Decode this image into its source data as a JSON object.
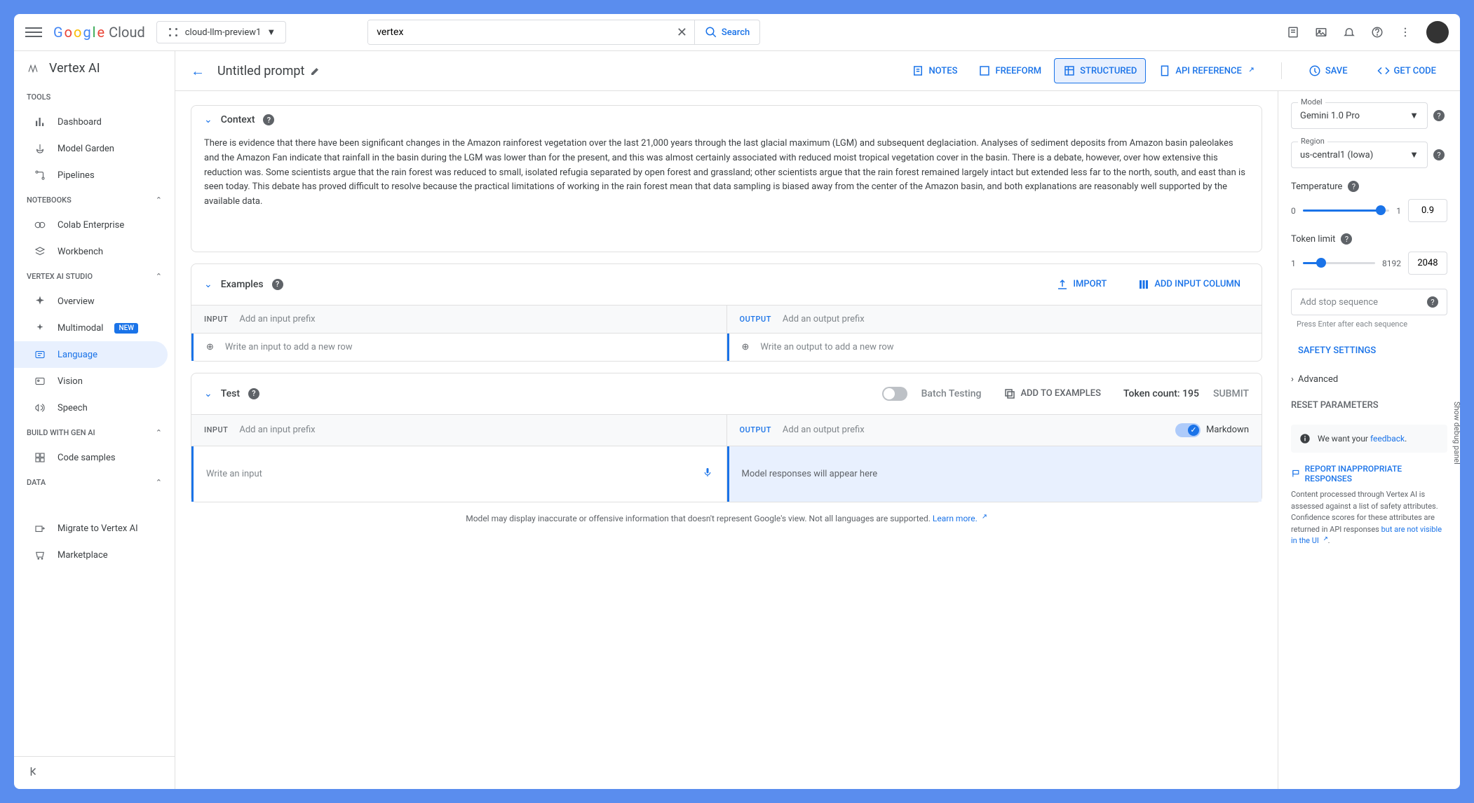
{
  "header": {
    "logo_cloud": "Cloud",
    "project": "cloud-llm-preview1",
    "search_value": "vertex",
    "search_btn": "Search"
  },
  "sidebar": {
    "title": "Vertex AI",
    "tools_label": "TOOLS",
    "tools": [
      {
        "label": "Dashboard"
      },
      {
        "label": "Model Garden"
      },
      {
        "label": "Pipelines"
      }
    ],
    "notebooks_label": "NOTEBOOKS",
    "notebooks": [
      {
        "label": "Colab Enterprise"
      },
      {
        "label": "Workbench"
      }
    ],
    "studio_label": "VERTEX AI STUDIO",
    "studio": [
      {
        "label": "Overview"
      },
      {
        "label": "Multimodal",
        "badge": "NEW"
      },
      {
        "label": "Language"
      },
      {
        "label": "Vision"
      },
      {
        "label": "Speech"
      }
    ],
    "build_label": "BUILD WITH GEN AI",
    "build": [
      {
        "label": "Code samples"
      }
    ],
    "data_label": "DATA",
    "data": [
      {
        "label": "Migrate to Vertex AI"
      },
      {
        "label": "Marketplace"
      }
    ]
  },
  "content": {
    "title": "Untitled prompt",
    "tabs": {
      "notes": "NOTES",
      "freeform": "FREEFORM",
      "structured": "STRUCTURED",
      "api": "API REFERENCE"
    },
    "actions": {
      "save": "SAVE",
      "get_code": "GET CODE"
    },
    "context": {
      "title": "Context",
      "text": "There is evidence that there have been significant changes in the Amazon rainforest vegetation over the last 21,000 years through the last glacial maximum (LGM) and subsequent deglaciation. Analyses of sediment deposits from Amazon basin paleolakes and the Amazon Fan indicate that rainfall in the basin during the LGM was lower than for the present, and this was almost certainly associated with reduced moist tropical vegetation cover in the basin. There is a debate, however, over how extensive this reduction was. Some scientists argue that the rain forest was reduced to small, isolated refugia separated by open forest and grassland; other scientists argue that the rain forest remained largely intact but extended less far to the north, south, and east than is seen today. This debate has proved difficult to resolve because the practical limitations of working in the rain forest mean that data sampling is biased away from the center of the Amazon basin, and both explanations are reasonably well supported by the available data."
    },
    "examples": {
      "title": "Examples",
      "import": "IMPORT",
      "add_col": "ADD INPUT COLUMN",
      "input_label": "INPUT",
      "output_label": "OUTPUT",
      "input_prefix_ph": "Add an input prefix",
      "output_prefix_ph": "Add an output prefix",
      "write_input": "Write an input to add a new row",
      "write_output": "Write an output to add a new row"
    },
    "test": {
      "title": "Test",
      "batch": "Batch Testing",
      "add_examples": "ADD TO EXAMPLES",
      "token_count": "Token count: 195",
      "submit": "SUBMIT",
      "markdown": "Markdown",
      "write_input": "Write an input",
      "responses": "Model responses will appear here"
    },
    "disclaimer": "Model may display inaccurate or offensive information that doesn't represent Google's view. Not all languages are supported.",
    "learn_more": "Learn more."
  },
  "right": {
    "model_label": "Model",
    "model": "Gemini 1.0 Pro",
    "region_label": "Region",
    "region": "us-central1 (Iowa)",
    "temp_label": "Temperature",
    "temp_min": "0",
    "temp_max": "1",
    "temp_value": "0.9",
    "token_label": "Token limit",
    "token_min": "1",
    "token_max": "8192",
    "token_value": "2048",
    "stop_ph": "Add stop sequence",
    "stop_hint": "Press Enter after each sequence",
    "safety": "SAFETY SETTINGS",
    "advanced": "Advanced",
    "reset": "RESET PARAMETERS",
    "feedback_pre": "We want your ",
    "feedback_link": "feedback",
    "report": "REPORT INAPPROPRIATE RESPONSES",
    "content_disclaimer": "Content processed through Vertex AI is assessed against a list of safety attributes. Confidence scores for these attributes are returned in API responses ",
    "content_link": "but are not visible in the UI"
  },
  "debug": "Show debug panel"
}
